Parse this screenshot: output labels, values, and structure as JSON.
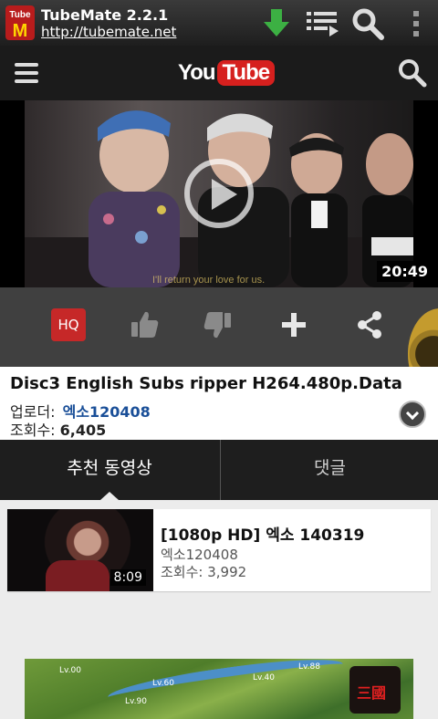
{
  "tubemate": {
    "title": "TubeMate 2.2.1",
    "url": "http://tubemate.net",
    "logo_text_top": "Tube",
    "logo_text_bottom": "M",
    "icons": [
      "download-arrow-icon",
      "playlist-icon",
      "search-icon",
      "overflow-menu-icon"
    ]
  },
  "youtube": {
    "logo_you": "You",
    "logo_tube": "Tube",
    "icons": [
      "menu-icon",
      "search-icon"
    ]
  },
  "video": {
    "duration": "20:49",
    "subtitle": "I'll return your love for us."
  },
  "actions": {
    "hq_label": "HQ",
    "icons": [
      "thumbs-up-icon",
      "thumbs-down-icon",
      "add-icon",
      "share-icon"
    ]
  },
  "info": {
    "title": "Disc3 English Subs ripper H264.480p.Data",
    "uploader_label": "업로더:",
    "uploader_name": "엑소120408",
    "views_label": "조회수:",
    "views_count": "6,405"
  },
  "tabs": [
    {
      "label": "추천 동영상",
      "active": true
    },
    {
      "label": "댓글",
      "active": false
    }
  ],
  "related": [
    {
      "title": "[1080p HD] 엑소 140319",
      "uploader": "엑소120408",
      "views": "조회수: 3,992",
      "duration": "8:09"
    }
  ],
  "ad": {
    "labels": [
      "Lv.00",
      "Lv.60",
      "Lv.90",
      "Lv.40",
      "Lv.88"
    ]
  },
  "colors": {
    "youtube_red": "#d6201e",
    "hq_red": "#c62828",
    "uploader_blue": "#1a4f98",
    "download_green": "#3cb043"
  }
}
